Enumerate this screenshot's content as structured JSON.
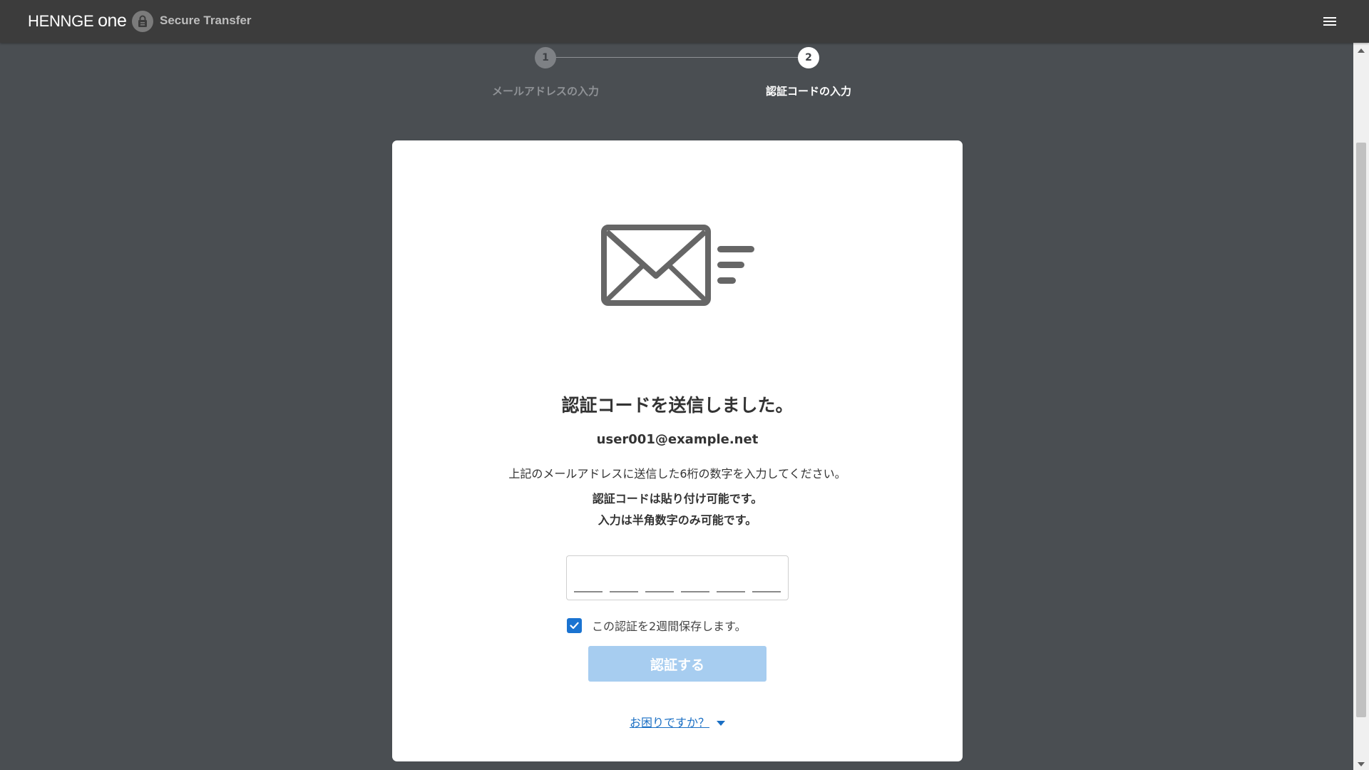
{
  "header": {
    "brand": "HENNGE",
    "brand_suffix": "one",
    "product_name": "Secure Transfer",
    "product_icon": "lock-icon",
    "menu_icon": "hamburger-menu-icon"
  },
  "stepper": {
    "steps": [
      {
        "number": "1",
        "label": "メールアドレスの入力",
        "state": "completed"
      },
      {
        "number": "2",
        "label": "認証コードの入力",
        "state": "active"
      }
    ]
  },
  "card": {
    "icon": "mail-sent-icon",
    "title": "認証コードを送信しました。",
    "email": "user001@example.net",
    "instruction": "上記のメールアドレスに送信した6桁の数字を入力してください。",
    "note_paste": "認証コードは貼り付け可能です。",
    "note_digits": "入力は半角数字のみ可能です。",
    "code_input": {
      "value": "",
      "digits": 6
    },
    "remember": {
      "label": "この認証を2週間保存します。",
      "checked": true
    },
    "verify_button": {
      "label": "認証する",
      "enabled": false
    },
    "help_link": "お困りですか？"
  },
  "colors": {
    "page_bg": "#4a4e52",
    "header_bg": "#3c3c3c",
    "accent": "#1a73d1",
    "button_disabled": "#a7cdf0",
    "link": "#1a6fc4"
  }
}
